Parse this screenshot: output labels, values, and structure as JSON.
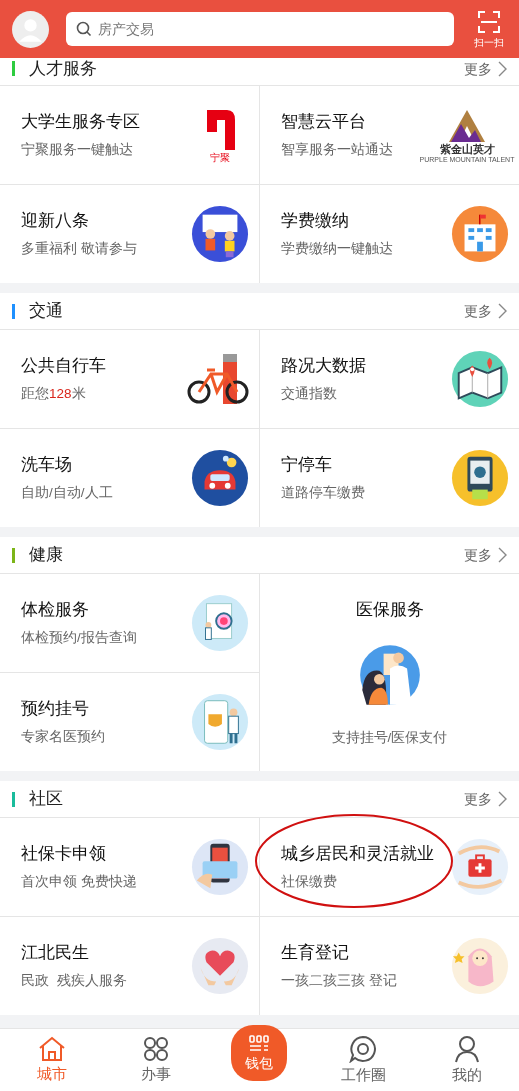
{
  "header": {
    "search": {
      "placeholder": "房产交易"
    },
    "scan_label": "扫一扫"
  },
  "sections": [
    {
      "title": "人才服务",
      "color": "#2ecc40",
      "more": "更多",
      "items": [
        {
          "kind": "cell",
          "title": "大学生服务专区",
          "subtitle": [
            {
              "text": "宁聚服务一键触达",
              "highlight": false
            }
          ],
          "logo_caption": "宁聚"
        },
        {
          "kind": "cell",
          "title": "智慧云平台",
          "subtitle": [
            {
              "text": "智享服务一站通达",
              "highlight": false
            }
          ],
          "logo_caption": "紫金山英才",
          "logo_subcaption": "PURPLE MOUNTAIN TALENT"
        },
        {
          "kind": "cell",
          "title": "迎新八条",
          "subtitle": [
            {
              "text": "多重福利 敬请参与",
              "highlight": false
            }
          ]
        },
        {
          "kind": "cell",
          "title": "学费缴纳",
          "subtitle": [
            {
              "text": "学费缴纳一键触达",
              "highlight": false
            }
          ]
        }
      ]
    },
    {
      "title": "交通",
      "color": "#1e90ff",
      "more": "更多",
      "items": [
        {
          "kind": "cell",
          "title": "公共自行车",
          "subtitle": [
            {
              "text": "距您",
              "highlight": false
            },
            {
              "text": "128",
              "highlight": true
            },
            {
              "text": "米",
              "highlight": false
            }
          ]
        },
        {
          "kind": "cell",
          "title": "路况大数据",
          "subtitle": [
            {
              "text": "交通指数",
              "highlight": false
            }
          ]
        },
        {
          "kind": "cell",
          "title": "洗车场",
          "subtitle": [
            {
              "text": "自助/自动/人工",
              "highlight": false
            }
          ]
        },
        {
          "kind": "cell",
          "title": "宁停车",
          "subtitle": [
            {
              "text": "道路停车缴费",
              "highlight": false
            }
          ]
        }
      ]
    },
    {
      "title": "健康",
      "color": "#7cb518",
      "more": "更多",
      "items": [
        {
          "kind": "cell",
          "title": "体检服务",
          "subtitle": [
            {
              "text": "体检预约/报告查询",
              "highlight": false
            }
          ]
        },
        {
          "kind": "cell",
          "title": "预约挂号",
          "subtitle": [
            {
              "text": "专家名医预约",
              "highlight": false
            }
          ]
        },
        {
          "kind": "tall",
          "title": "医保服务",
          "subtitle": [
            {
              "text": "支持挂号/医保支付",
              "highlight": false
            }
          ]
        }
      ]
    },
    {
      "title": "社区",
      "color": "#1abc9c",
      "more": "更多",
      "items": [
        {
          "kind": "cell",
          "title": "社保卡申领",
          "subtitle": [
            {
              "text": "首次申领 免费快递",
              "highlight": false
            }
          ]
        },
        {
          "kind": "cell",
          "title": "城乡居民和灵活就业",
          "subtitle": [
            {
              "text": "社保缴费",
              "highlight": false
            }
          ],
          "circled": true
        },
        {
          "kind": "cell",
          "title": "江北民生",
          "subtitle": [
            {
              "text": "民政  残疾人服务",
              "highlight": false
            }
          ]
        },
        {
          "kind": "cell",
          "title": "生育登记",
          "subtitle": [
            {
              "text": "一孩二孩三孩 登记",
              "highlight": false
            }
          ]
        }
      ]
    }
  ],
  "bottom_nav": [
    {
      "kind": "tab",
      "label": "城市",
      "selected": true
    },
    {
      "kind": "tab",
      "label": "办事",
      "selected": false
    },
    {
      "kind": "center",
      "label": "钱包",
      "selected": false
    },
    {
      "kind": "tab",
      "label": "工作圈",
      "selected": false
    },
    {
      "kind": "tab",
      "label": "我的",
      "selected": false
    }
  ]
}
